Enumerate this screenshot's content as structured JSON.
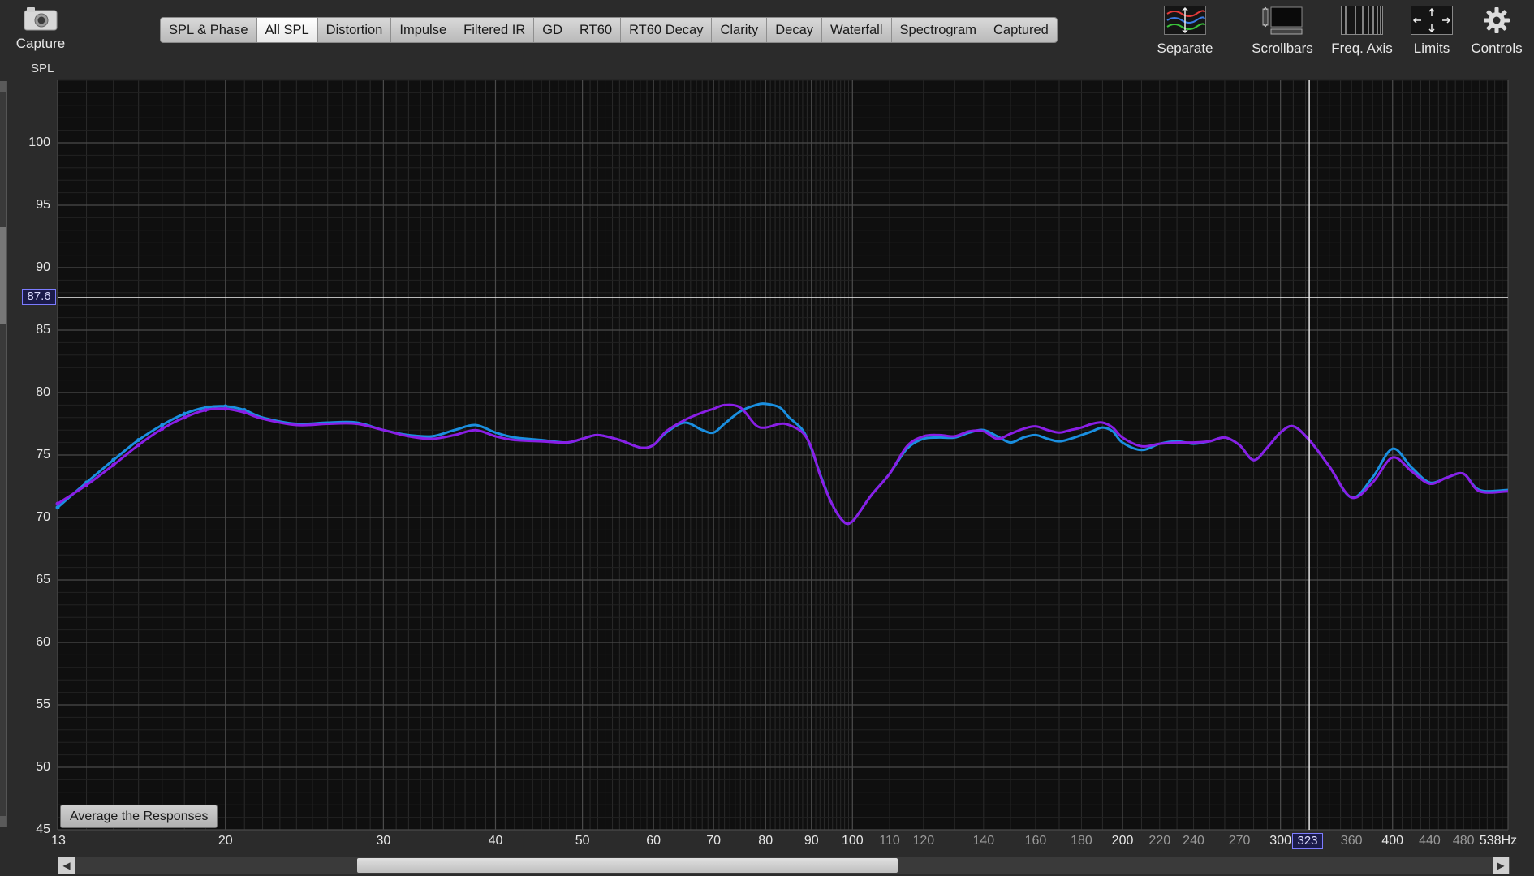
{
  "toolbar": {
    "capture_label": "Capture",
    "tabs": [
      {
        "label": "SPL & Phase",
        "active": false
      },
      {
        "label": "All SPL",
        "active": true
      },
      {
        "label": "Distortion",
        "active": false
      },
      {
        "label": "Impulse",
        "active": false
      },
      {
        "label": "Filtered IR",
        "active": false
      },
      {
        "label": "GD",
        "active": false
      },
      {
        "label": "RT60",
        "active": false
      },
      {
        "label": "RT60 Decay",
        "active": false
      },
      {
        "label": "Clarity",
        "active": false
      },
      {
        "label": "Decay",
        "active": false
      },
      {
        "label": "Waterfall",
        "active": false
      },
      {
        "label": "Spectrogram",
        "active": false
      },
      {
        "label": "Captured",
        "active": false
      }
    ],
    "tools": [
      {
        "label": "Separate",
        "icon": "separate-traces-icon"
      },
      {
        "label": "Scrollbars",
        "icon": "scrollbars-icon"
      },
      {
        "label": "Freq. Axis",
        "icon": "freq-axis-icon"
      },
      {
        "label": "Limits",
        "icon": "limits-icon"
      },
      {
        "label": "Controls",
        "icon": "gear-icon"
      }
    ]
  },
  "graph": {
    "y_axis_title": "SPL",
    "cursor_y_value": "87.6",
    "cursor_x_value": "323",
    "average_button_label": "Average the Responses"
  },
  "chart_data": {
    "type": "line",
    "x_scale": "log",
    "xlim": [
      13,
      538
    ],
    "ylim": [
      45,
      105
    ],
    "x_unit": "Hz",
    "grid": true,
    "y_ticks": [
      45,
      50,
      55,
      60,
      65,
      70,
      75,
      80,
      85,
      90,
      95,
      100
    ],
    "x_tick_labels": [
      {
        "value": 13,
        "label": "13",
        "major": true
      },
      {
        "value": 20,
        "label": "20",
        "major": true
      },
      {
        "value": 30,
        "label": "30",
        "major": true
      },
      {
        "value": 40,
        "label": "40",
        "major": true
      },
      {
        "value": 50,
        "label": "50",
        "major": true
      },
      {
        "value": 60,
        "label": "60",
        "major": true
      },
      {
        "value": 70,
        "label": "70",
        "major": true
      },
      {
        "value": 80,
        "label": "80",
        "major": true
      },
      {
        "value": 90,
        "label": "90",
        "major": true
      },
      {
        "value": 100,
        "label": "100",
        "major": true
      },
      {
        "value": 110,
        "label": "110",
        "major": false
      },
      {
        "value": 120,
        "label": "120",
        "major": false
      },
      {
        "value": 140,
        "label": "140",
        "major": false
      },
      {
        "value": 160,
        "label": "160",
        "major": false
      },
      {
        "value": 180,
        "label": "180",
        "major": false
      },
      {
        "value": 200,
        "label": "200",
        "major": true
      },
      {
        "value": 220,
        "label": "220",
        "major": false
      },
      {
        "value": 240,
        "label": "240",
        "major": false
      },
      {
        "value": 270,
        "label": "270",
        "major": false
      },
      {
        "value": 300,
        "label": "300",
        "major": true
      },
      {
        "value": 360,
        "label": "360",
        "major": false
      },
      {
        "value": 400,
        "label": "400",
        "major": true
      },
      {
        "value": 440,
        "label": "440",
        "major": false
      },
      {
        "value": 480,
        "label": "480",
        "major": false
      },
      {
        "value": 538,
        "label": "538Hz",
        "major": true
      }
    ],
    "cursor": {
      "x": 323,
      "y": 87.6
    },
    "series": [
      {
        "color": "#1a8fe0",
        "x": [
          13,
          14,
          15,
          16,
          17,
          18,
          19,
          20,
          21,
          22,
          24,
          26,
          28,
          30,
          32,
          34,
          36,
          38,
          40,
          42,
          45,
          48,
          50,
          52,
          55,
          58,
          60,
          62,
          65,
          68,
          70,
          72,
          75,
          78,
          80,
          83,
          85,
          88,
          90,
          92,
          95,
          98,
          100,
          102,
          105,
          110,
          115,
          120,
          125,
          130,
          135,
          140,
          145,
          150,
          155,
          160,
          165,
          170,
          175,
          180,
          185,
          190,
          195,
          200,
          210,
          220,
          230,
          240,
          250,
          260,
          270,
          280,
          290,
          300,
          310,
          323,
          340,
          360,
          380,
          400,
          420,
          440,
          460,
          480,
          500,
          538
        ],
        "y": [
          70.8,
          72.8,
          74.6,
          76.2,
          77.4,
          78.3,
          78.8,
          78.9,
          78.6,
          78.0,
          77.5,
          77.6,
          77.6,
          77.0,
          76.6,
          76.5,
          77.0,
          77.4,
          76.8,
          76.4,
          76.2,
          76.0,
          76.3,
          76.6,
          76.2,
          75.6,
          75.8,
          76.8,
          77.6,
          77.0,
          76.8,
          77.5,
          78.5,
          79.0,
          79.1,
          78.8,
          78.0,
          77.0,
          75.5,
          73.5,
          71.0,
          69.6,
          69.7,
          70.5,
          71.8,
          73.5,
          75.5,
          76.3,
          76.4,
          76.4,
          76.8,
          77.0,
          76.5,
          76.0,
          76.4,
          76.6,
          76.3,
          76.1,
          76.3,
          76.6,
          76.9,
          77.2,
          76.9,
          76.0,
          75.4,
          75.9,
          76.1,
          75.9,
          76.1,
          76.4,
          75.8,
          74.6,
          75.6,
          76.8,
          77.3,
          76.2,
          74.1,
          71.6,
          73.2,
          75.5,
          74.0,
          72.8,
          73.2,
          73.5,
          72.2,
          72.2
        ]
      },
      {
        "color": "#8a1ee6",
        "x": [
          13,
          14,
          15,
          16,
          17,
          18,
          19,
          20,
          21,
          22,
          24,
          26,
          28,
          30,
          32,
          34,
          36,
          38,
          40,
          42,
          45,
          48,
          50,
          52,
          55,
          58,
          60,
          62,
          65,
          68,
          70,
          72,
          75,
          78,
          80,
          83,
          85,
          88,
          90,
          92,
          95,
          98,
          100,
          102,
          105,
          110,
          115,
          120,
          125,
          130,
          135,
          140,
          145,
          150,
          155,
          160,
          165,
          170,
          175,
          180,
          185,
          190,
          195,
          200,
          210,
          220,
          230,
          240,
          250,
          260,
          270,
          280,
          290,
          300,
          310,
          323,
          340,
          360,
          380,
          400,
          420,
          440,
          460,
          480,
          500,
          538
        ],
        "y": [
          71.1,
          72.6,
          74.2,
          75.8,
          77.1,
          78.0,
          78.6,
          78.7,
          78.4,
          77.9,
          77.4,
          77.5,
          77.5,
          77.0,
          76.5,
          76.3,
          76.6,
          77.0,
          76.5,
          76.2,
          76.1,
          76.0,
          76.3,
          76.6,
          76.2,
          75.6,
          75.8,
          76.9,
          77.8,
          78.4,
          78.7,
          79.0,
          78.8,
          77.4,
          77.2,
          77.5,
          77.4,
          76.8,
          75.6,
          73.4,
          71.0,
          69.6,
          69.7,
          70.5,
          71.8,
          73.5,
          75.7,
          76.5,
          76.6,
          76.5,
          76.9,
          76.9,
          76.3,
          76.7,
          77.1,
          77.3,
          77.0,
          76.8,
          77.0,
          77.2,
          77.5,
          77.6,
          77.2,
          76.4,
          75.7,
          75.9,
          76.0,
          76.0,
          76.1,
          76.4,
          75.8,
          74.6,
          75.6,
          76.8,
          77.3,
          76.2,
          74.1,
          71.6,
          72.8,
          74.8,
          73.7,
          72.7,
          73.2,
          73.5,
          72.1,
          72.1
        ]
      }
    ]
  }
}
